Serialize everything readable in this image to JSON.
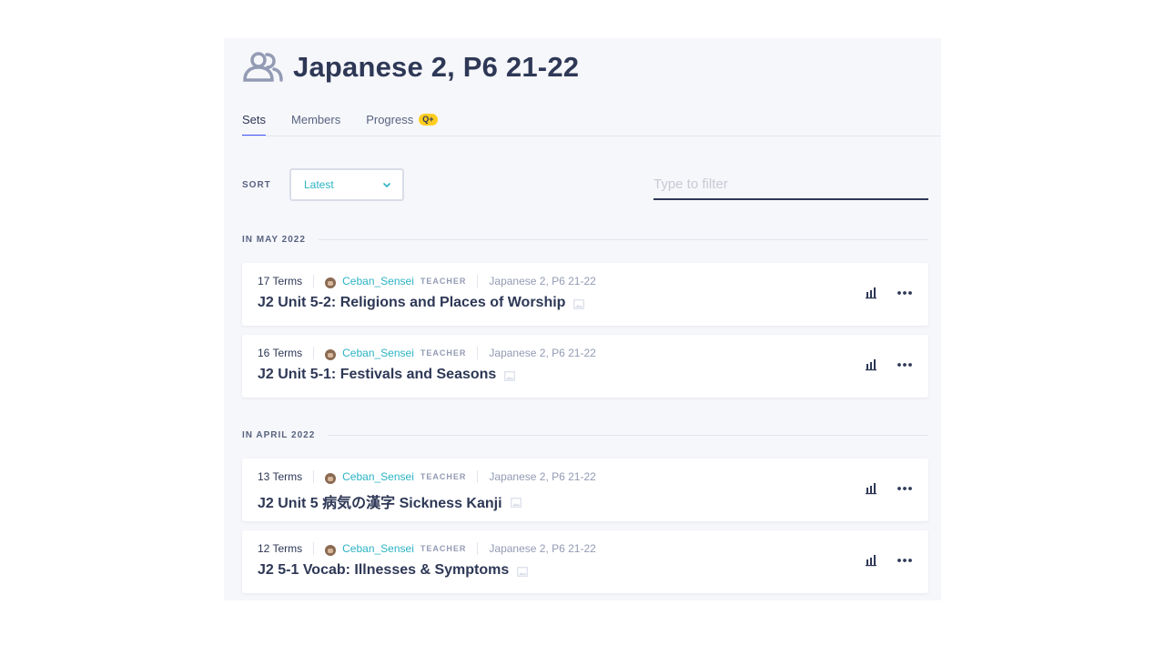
{
  "class_page": {
    "title": "Japanese 2, P6 21-22",
    "tabs": [
      {
        "label": "Sets",
        "active": true
      },
      {
        "label": "Members",
        "active": false
      },
      {
        "label": "Progress",
        "active": false,
        "badge": "Q+"
      }
    ]
  },
  "toolbar": {
    "sort_label": "SORT",
    "sort_value": "Latest",
    "filter_placeholder": "Type to filter"
  },
  "groups": [
    {
      "label": "IN MAY 2022",
      "sets": [
        {
          "terms": "17 Terms",
          "author": "Ceban_Sensei",
          "role": "TEACHER",
          "class": "Japanese 2, P6 21-22",
          "title": "J2 Unit 5-2: Religions and Places of Worship"
        },
        {
          "terms": "16 Terms",
          "author": "Ceban_Sensei",
          "role": "TEACHER",
          "class": "Japanese 2, P6 21-22",
          "title": "J2 Unit 5-1: Festivals and Seasons"
        }
      ]
    },
    {
      "label": "IN APRIL 2022",
      "sets": [
        {
          "terms": "13 Terms",
          "author": "Ceban_Sensei",
          "role": "TEACHER",
          "class": "Japanese 2, P6 21-22",
          "title": "J2 Unit 5 病気の漢字 Sickness Kanji"
        },
        {
          "terms": "12 Terms",
          "author": "Ceban_Sensei",
          "role": "TEACHER",
          "class": "Japanese 2, P6 21-22",
          "title": "J2 5-1 Vocab: Illnesses & Symptoms"
        }
      ]
    }
  ],
  "colors": {
    "accent": "#4255ff",
    "link": "#2bb3c4",
    "badge": "#ffcd1f",
    "text": "#2e3856",
    "muted": "#939bb4",
    "panel_bg": "#f6f7fb"
  },
  "icons": {
    "class": "class-members-icon",
    "sort": "chevron-down-icon",
    "avatar": "owl-avatar-icon",
    "image": "image-icon",
    "stats": "bar-chart-icon",
    "more": "more-options-icon"
  }
}
